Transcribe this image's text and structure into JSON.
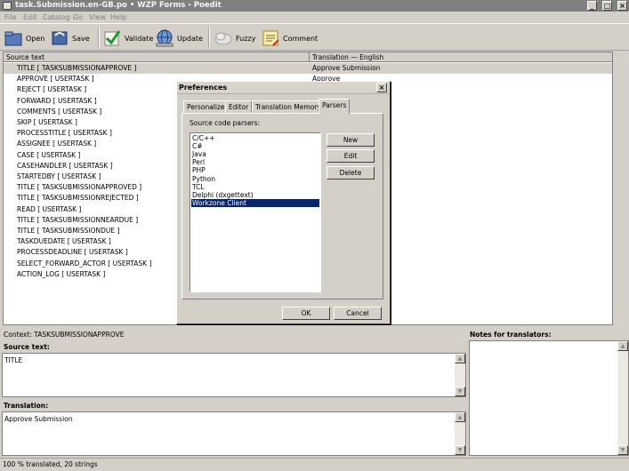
{
  "window": {
    "title": "task.Submission.en-GB.po • WZP Forms - Poedit"
  },
  "window_controls": {
    "minimize": "_",
    "maximize": "□",
    "close": "×"
  },
  "menu": [
    "File",
    "Edit",
    "Catalog",
    "Go",
    "View",
    "Help"
  ],
  "toolbar": {
    "open": "Open",
    "save": "Save",
    "validate": "Validate",
    "update": "Update",
    "fuzzy": "Fuzzy",
    "comment": "Comment"
  },
  "list": {
    "columns": [
      "Source text",
      "Translation — English"
    ],
    "rows": [
      {
        "source": "TITLE  [ TASKSUBMISSIONAPPROVE ]",
        "translation": "Approve Submission"
      },
      {
        "source": "APPROVE  [ USERTASK ]",
        "translation": "Approve"
      },
      {
        "source": "REJECT  [ USERTASK ]",
        "translation": ""
      },
      {
        "source": "FORWARD  [ USERTASK ]",
        "translation": ""
      },
      {
        "source": "COMMENTS  [ USERTASK ]",
        "translation": ""
      },
      {
        "source": "SKIP  [ USERTASK ]",
        "translation": ""
      },
      {
        "source": "PROCESSTITLE  [ USERTASK ]",
        "translation": ""
      },
      {
        "source": "ASSIGNEE  [ USERTASK ]",
        "translation": ""
      },
      {
        "source": "CASE  [ USERTASK ]",
        "translation": ""
      },
      {
        "source": "CASEHANDLER  [ USERTASK ]",
        "translation": ""
      },
      {
        "source": "STARTEDBY  [ USERTASK ]",
        "translation": ""
      },
      {
        "source": "TITLE  [ TASKSUBMISSIONAPPROVED ]",
        "translation": ""
      },
      {
        "source": "TITLE  [ TASKSUBMISSIONREJECTED ]",
        "translation": ""
      },
      {
        "source": "READ  [ USERTASK ]",
        "translation": ""
      },
      {
        "source": "TITLE  [ TASKSUBMISSIONNEARDUE ]",
        "translation": ""
      },
      {
        "source": "TITLE  [ TASKSUBMISSIONDUE ]",
        "translation": ""
      },
      {
        "source": "TASKDUEDATE  [ USERTASK ]",
        "translation": ""
      },
      {
        "source": "PROCESSDEADLINE  [ USERTASK ]",
        "translation": ""
      },
      {
        "source": "SELECT_FORWARD_ACTOR  [ USERTASK ]",
        "translation": ""
      },
      {
        "source": "ACTION_LOG  [ USERTASK ]",
        "translation": ""
      }
    ],
    "selected_index": 0
  },
  "details": {
    "context": "Context: TASKSUBMISSIONAPPROVE",
    "source_heading": "Source text:",
    "source_value": "TITLE",
    "translation_heading": "Translation:",
    "translation_value": "Approve Submission",
    "notes_heading": "Notes for translators:"
  },
  "status": "100 % translated, 20 strings",
  "dialog": {
    "title": "Preferences",
    "tabs": [
      "Personalize",
      "Editor",
      "Translation Memory",
      "Parsers"
    ],
    "active_tab": "Parsers",
    "parsers_label": "Source code parsers:",
    "parsers": [
      "C/C++",
      "C#",
      "Java",
      "Perl",
      "PHP",
      "Python",
      "TCL",
      "Delphi (dxgettext)",
      "Workzone Client"
    ],
    "selected_parser": "Workzone Client",
    "buttons": {
      "new": "New",
      "edit": "Edit",
      "delete": "Delete",
      "ok": "OK",
      "cancel": "Cancel"
    },
    "close": "×"
  },
  "colors": {
    "selection": "#0a246a",
    "face": "#d4d0c8",
    "titlebar": "#808080"
  }
}
